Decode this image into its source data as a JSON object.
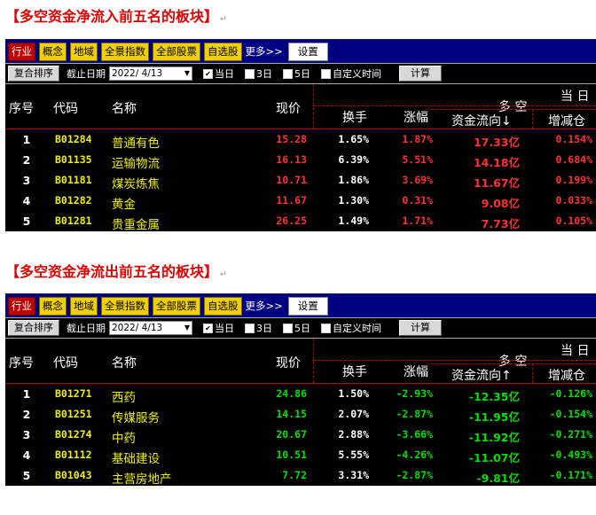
{
  "colors": {
    "up": "#ff3030",
    "down": "#00e000",
    "code": "#f0f000",
    "name": "#f0f000",
    "white": "#ffffff"
  },
  "toolbar": {
    "tabs": [
      "行业",
      "概念",
      "地域",
      "全景指数",
      "全部股票",
      "自选股"
    ],
    "more": "更多>>",
    "settings": "设置"
  },
  "controls": {
    "sort_button": "复合排序",
    "date_label": "截止日期",
    "date_value": "2022/ 4/13",
    "options": [
      {
        "label": "当日",
        "checked": true
      },
      {
        "label": "3日",
        "checked": false
      },
      {
        "label": "5日",
        "checked": false
      },
      {
        "label": "自定义时间",
        "checked": false
      }
    ],
    "calc_button": "计算"
  },
  "columns": {
    "seq": "序号",
    "code": "代码",
    "name": "名称",
    "price": "现价",
    "group_top": "当 日",
    "turnover": "换手",
    "change": "涨幅",
    "group_mid": "多 空",
    "increase": "增减仓"
  },
  "sections": [
    {
      "title": "【多空资金净流入前五名的板块】",
      "flow_header": "资金流向↓",
      "value_color": "up",
      "rows": [
        {
          "seq": "1",
          "code": "B01284",
          "name": "普通有色",
          "price": "15.28",
          "turnover": "1.65%",
          "change": "1.87%",
          "flow": "17.33亿",
          "delta": "0.154%"
        },
        {
          "seq": "2",
          "code": "B01135",
          "name": "运输物流",
          "price": "16.13",
          "turnover": "6.39%",
          "change": "5.51%",
          "flow": "14.18亿",
          "delta": "0.684%"
        },
        {
          "seq": "3",
          "code": "B01181",
          "name": "煤炭炼焦",
          "price": "10.71",
          "turnover": "1.86%",
          "change": "3.69%",
          "flow": "11.67亿",
          "delta": "0.199%"
        },
        {
          "seq": "4",
          "code": "B01282",
          "name": "黄金",
          "price": "11.67",
          "turnover": "1.30%",
          "change": "0.31%",
          "flow": "9.08亿",
          "delta": "0.033%"
        },
        {
          "seq": "5",
          "code": "B01281",
          "name": "贵重金属",
          "price": "26.25",
          "turnover": "1.49%",
          "change": "1.71%",
          "flow": "7.73亿",
          "delta": "0.105%"
        }
      ]
    },
    {
      "title": "【多空资金净流出前五名的板块】",
      "flow_header": "资金流向↑",
      "value_color": "down",
      "rows": [
        {
          "seq": "1",
          "code": "B01271",
          "name": "西药",
          "price": "24.86",
          "turnover": "1.50%",
          "change": "-2.93%",
          "flow": "-12.35亿",
          "delta": "-0.126%"
        },
        {
          "seq": "2",
          "code": "B01251",
          "name": "传媒服务",
          "price": "14.15",
          "turnover": "2.07%",
          "change": "-2.87%",
          "flow": "-11.95亿",
          "delta": "-0.154%"
        },
        {
          "seq": "3",
          "code": "B01274",
          "name": "中药",
          "price": "20.67",
          "turnover": "2.88%",
          "change": "-3.66%",
          "flow": "-11.92亿",
          "delta": "-0.271%"
        },
        {
          "seq": "4",
          "code": "B01112",
          "name": "基础建设",
          "price": "10.51",
          "turnover": "5.55%",
          "change": "-4.26%",
          "flow": "-11.07亿",
          "delta": "-0.493%"
        },
        {
          "seq": "5",
          "code": "B01043",
          "name": "主营房地产",
          "price": "7.72",
          "turnover": "3.31%",
          "change": "-2.87%",
          "flow": "-9.81亿",
          "delta": "-0.171%"
        }
      ]
    }
  ]
}
